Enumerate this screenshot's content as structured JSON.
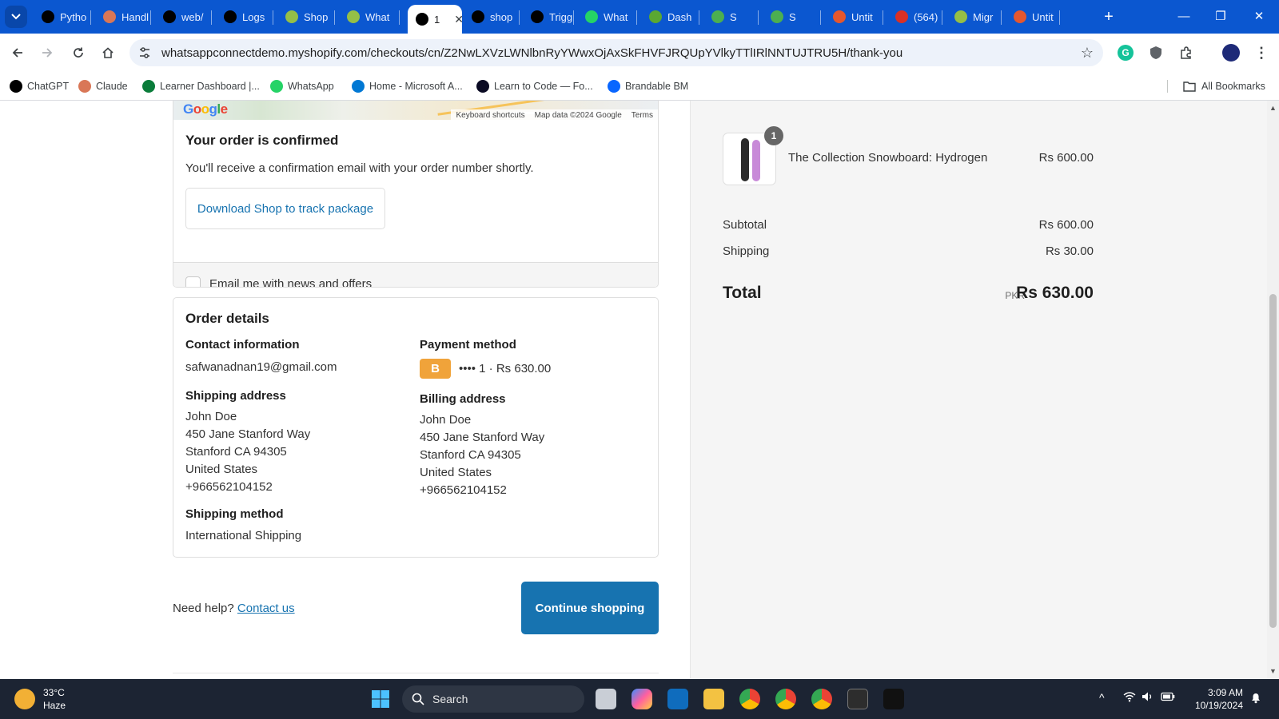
{
  "browser": {
    "tabs": [
      {
        "label": "Pytho",
        "icon": "chatgpt-icon",
        "color": "#000000"
      },
      {
        "label": "Handl",
        "icon": "claude-icon",
        "color": "#d97757"
      },
      {
        "label": "web/",
        "icon": "chatgpt-icon",
        "color": "#000000"
      },
      {
        "label": "Logs",
        "icon": "chatgpt-icon",
        "color": "#000000"
      },
      {
        "label": "Shop",
        "icon": "shopify-icon",
        "color": "#95bf47"
      },
      {
        "label": "What",
        "icon": "shopify-icon",
        "color": "#95bf47"
      },
      {
        "label": "1",
        "icon": "chatgpt-icon",
        "color": "#000000",
        "active": true
      },
      {
        "label": "shop",
        "icon": "doc-icon",
        "color": "#000000"
      },
      {
        "label": "Trigg",
        "icon": "doc-icon",
        "color": "#000000"
      },
      {
        "label": "What",
        "icon": "whatsapp-icon",
        "color": "#25d366"
      },
      {
        "label": "Dash",
        "icon": "leaf-icon",
        "color": "#5aa832"
      },
      {
        "label": "S",
        "icon": "globe-icon",
        "color": "#4caf50"
      },
      {
        "label": "S",
        "icon": "globe-icon",
        "color": "#4caf50"
      },
      {
        "label": "Untit",
        "icon": "app-icon",
        "color": "#e4572e"
      },
      {
        "label": "(564)",
        "icon": "mail-icon",
        "color": "#d93025"
      },
      {
        "label": "Migr",
        "icon": "shopify-icon",
        "color": "#95bf47"
      },
      {
        "label": "Untit",
        "icon": "app-icon",
        "color": "#e4572e"
      }
    ],
    "url": "whatsappconnectdemo.myshopify.com/checkouts/cn/Z2NwLXVzLWNlbnRyYWwxOjAxSkFHVFJRQUpYVlkyTTlIRlNNTUJTRU5H/thank-you",
    "bookmarks": [
      {
        "label": "ChatGPT",
        "color": "#000000"
      },
      {
        "label": "Claude",
        "color": "#d97757"
      },
      {
        "label": "Learner Dashboard |...",
        "color": "#0a7c3a"
      },
      {
        "label": "WhatsApp",
        "color": "#25d366"
      },
      {
        "label": "Home - Microsoft A...",
        "color": "#0078d4"
      },
      {
        "label": "Learn to Code — Fo...",
        "color": "#0a0a23"
      },
      {
        "label": "Brandable BM",
        "color": "#0866ff"
      }
    ],
    "all_bookmarks": "All Bookmarks"
  },
  "map": {
    "logo": "Google",
    "shortcuts": "Keyboard shortcuts",
    "map_data": "Map data ©2024 Google",
    "terms": "Terms"
  },
  "confirmation": {
    "title": "Your order is confirmed",
    "text": "You'll receive a confirmation email with your order number shortly.",
    "shop_button": "Download Shop to track package",
    "newsletter_label": "Email me with news and offers",
    "newsletter_checked": false
  },
  "order_details": {
    "title": "Order details",
    "contact_label": "Contact information",
    "contact_email": "safwanadnan19@gmail.com",
    "payment_label": "Payment method",
    "payment_badge": "B",
    "payment_text": "•••• 1 · Rs 630.00",
    "shipping_address_label": "Shipping address",
    "shipping_address": [
      "John Doe",
      "450 Jane Stanford Way",
      "Stanford CA 94305",
      "United States",
      "+966562104152"
    ],
    "billing_address_label": "Billing address",
    "billing_address": [
      "John Doe",
      "450 Jane Stanford Way",
      "Stanford CA 94305",
      "United States",
      "+966562104152"
    ],
    "shipping_method_label": "Shipping method",
    "shipping_method": "International Shipping"
  },
  "footer": {
    "help_text": "Need help?",
    "contact_link": "Contact us",
    "continue_button": "Continue shopping"
  },
  "summary": {
    "item_quantity": "1",
    "item_name": "The Collection Snowboard: Hydrogen",
    "item_price": "Rs 600.00",
    "subtotal_label": "Subtotal",
    "subtotal_value": "Rs 600.00",
    "shipping_label": "Shipping",
    "shipping_value": "Rs 30.00",
    "total_label": "Total",
    "total_currency": "PKR",
    "total_value": "Rs 630.00"
  },
  "taskbar": {
    "temperature": "33°C",
    "weather": "Haze",
    "search": "Search",
    "time": "3:09 AM",
    "date": "10/19/2024"
  },
  "colors": {
    "accent": "#1773b0",
    "chrome_frame": "#0b57d0",
    "payment_badge": "#f0a33a"
  }
}
